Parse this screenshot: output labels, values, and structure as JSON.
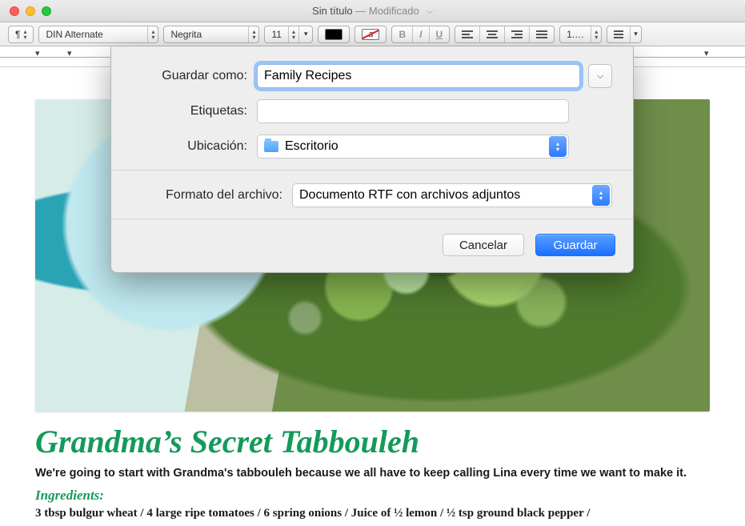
{
  "window": {
    "title": "Sin título",
    "modified": "Modificado"
  },
  "toolbar": {
    "paragraph_mark": "¶",
    "font": "DIN Alternate",
    "style": "Negrita",
    "size": "11",
    "spacing": "1.…",
    "text_color": "#000000",
    "highlight_label": "a"
  },
  "sheet": {
    "save_as_label": "Guardar como:",
    "save_as_value": "Family Recipes",
    "tags_label": "Etiquetas:",
    "tags_value": "",
    "location_label": "Ubicación:",
    "location_value": "Escritorio",
    "file_format_label": "Formato del archivo:",
    "file_format_value": "Documento RTF con archivos adjuntos",
    "cancel": "Cancelar",
    "save": "Guardar"
  },
  "document": {
    "heading": "Grandma’s Secret Tabbouleh",
    "intro": "We're going to start with Grandma's tabbouleh because we all have to keep calling Lina every time we want to make it.",
    "ingredients_label": "Ingredients:",
    "ingredients_line": "3 tbsp bulgur wheat / 4 large ripe tomatoes / 6 spring onions / Juice of ½ lemon / ½ tsp ground black pepper /"
  }
}
